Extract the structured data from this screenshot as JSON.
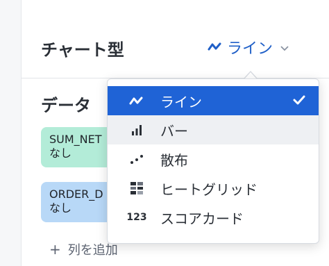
{
  "chart_type": {
    "label": "チャート型",
    "selected": "ライン",
    "accent_color": "#1f5fc7"
  },
  "data_section": {
    "heading": "データ",
    "fields": [
      {
        "name": "SUM_NET",
        "sub": "なし",
        "color": "#b3ecd8"
      },
      {
        "name": "ORDER_D",
        "sub": "なし",
        "color": "#b8d8f7"
      }
    ],
    "add_column": "列を追加"
  },
  "dropdown": {
    "selected_color": "#1f63d6",
    "items": [
      {
        "label": "ライン",
        "icon": "line-chart-icon",
        "selected": true
      },
      {
        "label": "バー",
        "icon": "bar-chart-icon",
        "hovered": true
      },
      {
        "label": "散布",
        "icon": "scatter-icon"
      },
      {
        "label": "ヒートグリッド",
        "icon": "heatgrid-icon"
      },
      {
        "label": "スコアカード",
        "icon": "scorecard-icon",
        "icon_text": "123"
      }
    ]
  }
}
